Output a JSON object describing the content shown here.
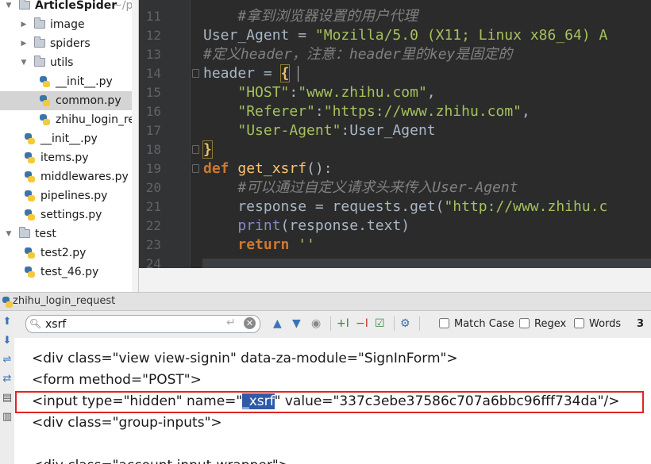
{
  "project_tree": {
    "items": [
      {
        "label": "ArticleSpider",
        "trail": "~/python",
        "kind": "folder",
        "indent": 0,
        "expanded": true
      },
      {
        "label": "image",
        "kind": "folder",
        "indent": 1,
        "expanded": false
      },
      {
        "label": "spiders",
        "kind": "folder",
        "indent": 1,
        "expanded": false
      },
      {
        "label": "utils",
        "kind": "folder",
        "indent": 1,
        "expanded": true
      },
      {
        "label": "__init__.py",
        "kind": "py",
        "indent": 2
      },
      {
        "label": "common.py",
        "kind": "py",
        "indent": 2,
        "selected": true
      },
      {
        "label": "zhihu_login_requ",
        "kind": "py",
        "indent": 2
      },
      {
        "label": "__init__.py",
        "kind": "py",
        "indent": 1
      },
      {
        "label": "items.py",
        "kind": "py",
        "indent": 1
      },
      {
        "label": "middlewares.py",
        "kind": "py",
        "indent": 1
      },
      {
        "label": "pipelines.py",
        "kind": "py",
        "indent": 1
      },
      {
        "label": "settings.py",
        "kind": "py",
        "indent": 1
      },
      {
        "label": "test",
        "kind": "folder",
        "indent": 0,
        "expanded": true
      },
      {
        "label": "test2.py",
        "kind": "py",
        "indent": 1
      },
      {
        "label": "test_46.py",
        "kind": "py",
        "indent": 1
      }
    ]
  },
  "editor": {
    "lines": [
      {
        "num": "11",
        "tokens": [
          {
            "t": "    #拿到浏览器设置的用户代理",
            "c": "cm"
          }
        ]
      },
      {
        "num": "12",
        "tokens": [
          {
            "t": "User_Agent = "
          },
          {
            "t": "\"Mozilla/5.0 (X11; Linux x86_64) A",
            "c": "str"
          }
        ]
      },
      {
        "num": "13",
        "tokens": [
          {
            "t": "#定义header，注意：header里的key是固定的",
            "c": "cm"
          }
        ]
      },
      {
        "num": "14",
        "tokens": [
          {
            "t": "header = "
          },
          {
            "t": "{",
            "c": "brace brace-box"
          }
        ]
      },
      {
        "num": "15",
        "tokens": [
          {
            "t": "    "
          },
          {
            "t": "\"HOST\"",
            "c": "str"
          },
          {
            "t": ":"
          },
          {
            "t": "\"www.zhihu.com\"",
            "c": "str"
          },
          {
            "t": ","
          }
        ]
      },
      {
        "num": "16",
        "tokens": [
          {
            "t": "    "
          },
          {
            "t": "\"Referer\"",
            "c": "str"
          },
          {
            "t": ":"
          },
          {
            "t": "\"https://www.zhihu.com\"",
            "c": "str"
          },
          {
            "t": ","
          }
        ]
      },
      {
        "num": "17",
        "tokens": [
          {
            "t": "    "
          },
          {
            "t": "\"User-Agent\"",
            "c": "str"
          },
          {
            "t": ":User_Agent"
          }
        ]
      },
      {
        "num": "18",
        "tokens": [
          {
            "t": "}",
            "c": "brace brace-box"
          }
        ]
      },
      {
        "num": "19",
        "tokens": [
          {
            "t": "def ",
            "c": "kw"
          },
          {
            "t": "get_xsrf",
            "c": "fn"
          },
          {
            "t": "():"
          }
        ]
      },
      {
        "num": "20",
        "tokens": [
          {
            "t": "    "
          },
          {
            "t": "#可以通过自定义请求头来传入User-Agent",
            "c": "cm"
          }
        ]
      },
      {
        "num": "21",
        "tokens": [
          {
            "t": "    response = requests.get("
          },
          {
            "t": "\"http://www.zhihu.c",
            "c": "str"
          }
        ]
      },
      {
        "num": "22",
        "tokens": [
          {
            "t": "    "
          },
          {
            "t": "print",
            "c": "bi"
          },
          {
            "t": "(response.text)"
          }
        ]
      },
      {
        "num": "23",
        "tokens": [
          {
            "t": "    "
          },
          {
            "t": "return ",
            "c": "kw"
          },
          {
            "t": "''",
            "c": "str"
          }
        ]
      },
      {
        "num": "24",
        "tokens": [
          {
            "t": ""
          }
        ]
      }
    ]
  },
  "run_panel": {
    "title": "zhihu_login_request",
    "search": {
      "value": "xsrf",
      "placeholder": ""
    },
    "options": {
      "match_case": "Match Case",
      "regex": "Regex",
      "words": "Words"
    },
    "match_count": "3",
    "output_lines": [
      {
        "pre": "<div class=\"view view-signin\" data-za-module=\"SignInForm\">",
        "hl": "",
        "post": ""
      },
      {
        "pre": "<form method=\"POST\">",
        "hl": "",
        "post": ""
      },
      {
        "pre": "<input type=\"hidden\" name=\"",
        "hl": "_xsrf",
        "post": "\" value=\"337c3ebe37586c707a6bbc96fff734da\"/>"
      },
      {
        "pre": "<div class=\"group-inputs\">",
        "hl": "",
        "post": ""
      },
      {
        "pre": "",
        "hl": "",
        "post": ""
      },
      {
        "pre": "<div class=\"account input-wrapper\">",
        "hl": "",
        "post": ""
      }
    ]
  },
  "colors": {
    "editor_bg": "#2b2b2b",
    "highlight": "#2f5aa8",
    "annotation_box": "#e02424"
  }
}
